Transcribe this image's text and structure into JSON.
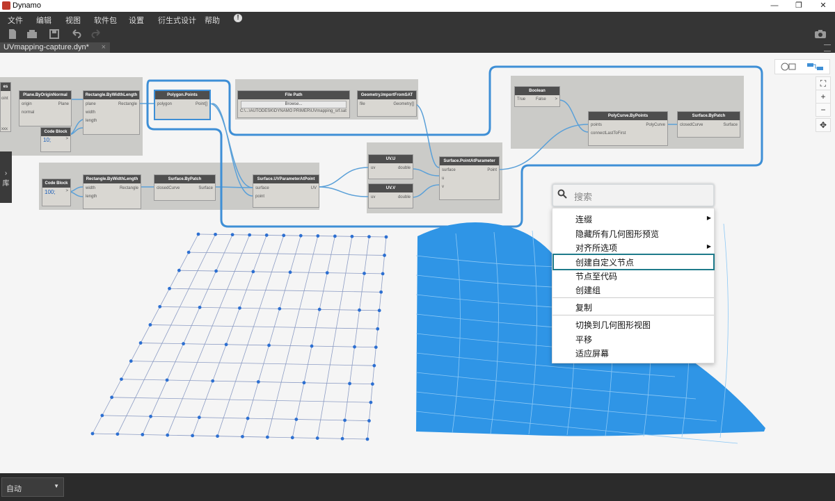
{
  "window": {
    "title": "Dynamo",
    "minimize": "—",
    "maximize": "❐",
    "close": "✕"
  },
  "menu": [
    "文件",
    "编辑",
    "视图",
    "软件包",
    "设置",
    "衍生式设计",
    "帮助",
    "!"
  ],
  "tab": {
    "label": "UVmapping-capture.dyn*",
    "close": "×"
  },
  "left_panel_label": "库",
  "nodes": {
    "plane": {
      "title": "Plane.ByOriginNormal",
      "in1": "origin",
      "in2": "normal",
      "out": "Plane"
    },
    "rect1": {
      "title": "Rectangle.ByWidthLength",
      "in1": "plane",
      "in2": "width",
      "in3": "length",
      "out": "Rectangle"
    },
    "cb1": {
      "title": "Code Block",
      "value": "10;",
      "port": ">"
    },
    "partial": {
      "title": "es",
      "port": "oint",
      "extra": "xxx"
    },
    "polypts": {
      "title": "Polygon.Points",
      "in1": "polygon",
      "out": "Point[]"
    },
    "filepath": {
      "title": "File Path",
      "button": "Browse...",
      "path": "C:\\...\\AUTODESK\\DYNAMO PRIMER\\UVmapping_srf.sat"
    },
    "import": {
      "title": "Geometry.ImportFromSAT",
      "in1": "file",
      "out": "Geometry[]"
    },
    "cb2": {
      "title": "Code Block",
      "value": "100;",
      "port": ">"
    },
    "rect2": {
      "title": "Rectangle.ByWidthLength",
      "in1": "width",
      "in2": "length",
      "out": "Rectangle"
    },
    "patch1": {
      "title": "Surface.ByPatch",
      "in1": "closedCurve",
      "out": "Surface"
    },
    "uvparam": {
      "title": "Surface.UVParameterAtPoint",
      "in1": "surface",
      "in2": "point",
      "out": "UV"
    },
    "uvu": {
      "title": "UV.U",
      "in1": "uv",
      "out": "double"
    },
    "uvv": {
      "title": "UV.V",
      "in1": "uv",
      "out": "double"
    },
    "ptatparam": {
      "title": "Surface.PointAtParameter",
      "in1": "surface",
      "in2": "u",
      "in3": "v",
      "out": "Point"
    },
    "bool": {
      "title": "Boolean",
      "opt1": "True",
      "opt2": "False",
      "port": ">"
    },
    "polycurve": {
      "title": "PolyCurve.ByPoints",
      "in1": "points",
      "in2": "connectLastToFirst",
      "out": "PolyCurve"
    },
    "patch2": {
      "title": "Surface.ByPatch",
      "in1": "closedCurve",
      "out": "Surface"
    }
  },
  "search": {
    "placeholder": "搜索"
  },
  "context_menu": {
    "items": [
      "连缀",
      "隐藏所有几何图形预览",
      "对齐所选项",
      "创建自定义节点",
      "节点至代码",
      "创建组",
      "复制",
      "切换到几何图形视图",
      "平移",
      "适应屏幕"
    ],
    "highlighted": "创建自定义节点"
  },
  "view_controls": {
    "fit": "⛶",
    "zoom_in": "+",
    "zoom_out": "−",
    "pan": "✥"
  },
  "run": {
    "mode": "自动",
    "dropdown": "▼"
  },
  "colors": {
    "accent": "#3e8fd6",
    "highlight_border": "#1e7a8a",
    "surface_blue": "#2f95e6"
  }
}
